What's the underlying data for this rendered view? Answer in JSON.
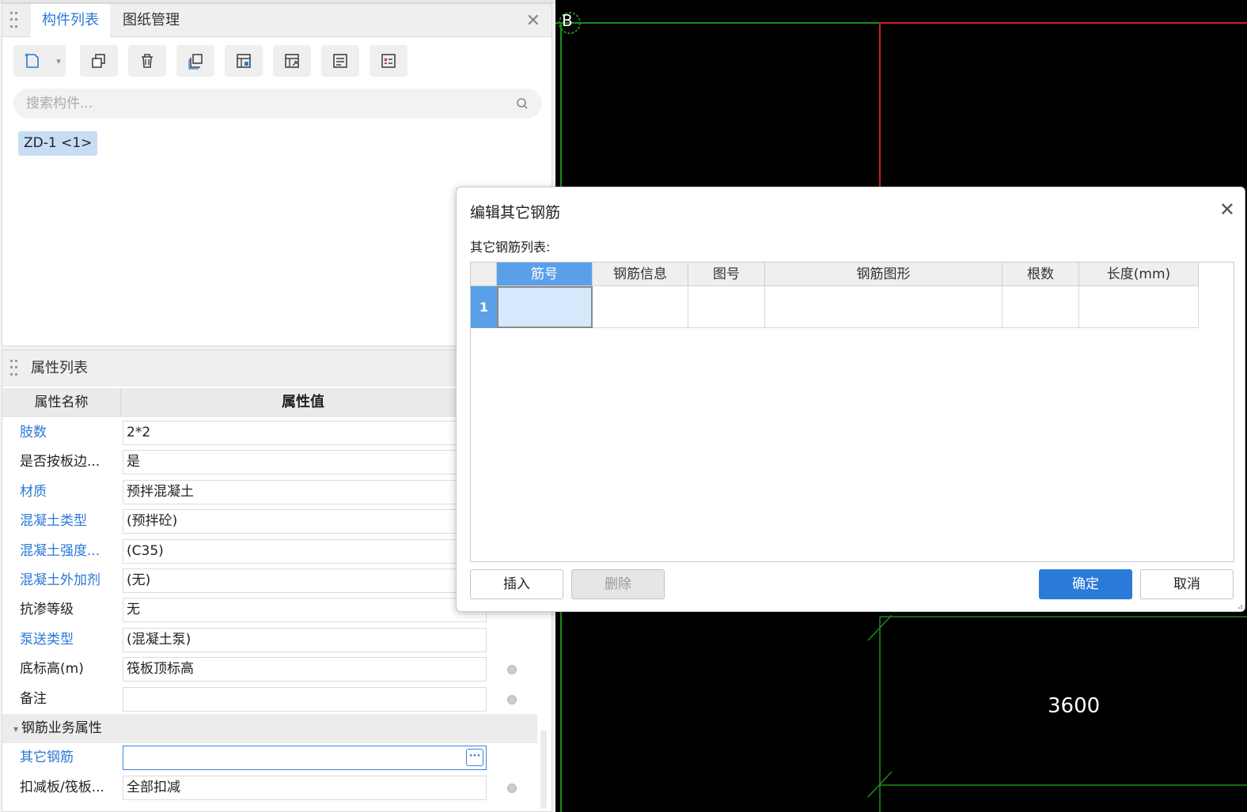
{
  "left_panel": {
    "tabs": [
      {
        "label": "构件列表",
        "active": true
      },
      {
        "label": "图纸管理",
        "active": false
      }
    ],
    "close_glyph": "✕",
    "toolbar_icons": [
      "new-component-icon",
      "copy-icon",
      "delete-icon",
      "duplicate-layer-icon",
      "import-icon",
      "export-icon",
      "filter-icon",
      "list-icon"
    ],
    "search": {
      "placeholder": "搜索构件..."
    },
    "components": [
      {
        "label": "ZD-1 <1>",
        "selected": true
      }
    ]
  },
  "properties": {
    "title": "属性列表",
    "col_name": "属性名称",
    "col_value": "属性值",
    "rows": [
      {
        "name": "肢数",
        "value": "2*2",
        "blue": true,
        "radio": false
      },
      {
        "name": "是否按板边...",
        "value": "是",
        "blue": false,
        "radio": false
      },
      {
        "name": "材质",
        "value": "预拌混凝土",
        "blue": true,
        "radio": false
      },
      {
        "name": "混凝土类型",
        "value": "(预拌砼)",
        "blue": true,
        "radio": false
      },
      {
        "name": "混凝土强度...",
        "value": "(C35)",
        "blue": true,
        "radio": false
      },
      {
        "name": "混凝土外加剂",
        "value": "(无)",
        "blue": true,
        "radio": false
      },
      {
        "name": "抗渗等级",
        "value": "无",
        "blue": false,
        "radio": false
      },
      {
        "name": "泵送类型",
        "value": "(混凝土泵)",
        "blue": true,
        "radio": false
      },
      {
        "name": "底标高(m)",
        "value": "筏板顶标高",
        "blue": false,
        "radio": true
      },
      {
        "name": "备注",
        "value": "",
        "blue": false,
        "radio": true
      }
    ],
    "group_label": "钢筋业务属性",
    "group_rows": [
      {
        "name": "其它钢筋",
        "value": "",
        "blue": true,
        "radio": false,
        "focused": true,
        "dots": "···"
      },
      {
        "name": "扣减板/筏板...",
        "value": "全部扣减",
        "blue": false,
        "radio": true
      }
    ]
  },
  "cad": {
    "axis_label": "B",
    "dimension": "3600",
    "colors": {
      "background": "#000000",
      "green": "#1e8c1e",
      "red": "#d01e1e"
    }
  },
  "dialog": {
    "title": "编辑其它钢筋",
    "close_glyph": "✕",
    "subtitle": "其它钢筋列表:",
    "columns": [
      "筋号",
      "钢筋信息",
      "图号",
      "钢筋图形",
      "根数",
      "长度(mm)"
    ],
    "rows": [
      {
        "num": "1",
        "cells": [
          "",
          "",
          "",
          "",
          "",
          ""
        ]
      }
    ],
    "buttons": {
      "insert": "插入",
      "delete": "删除",
      "ok": "确定",
      "cancel": "取消"
    }
  }
}
